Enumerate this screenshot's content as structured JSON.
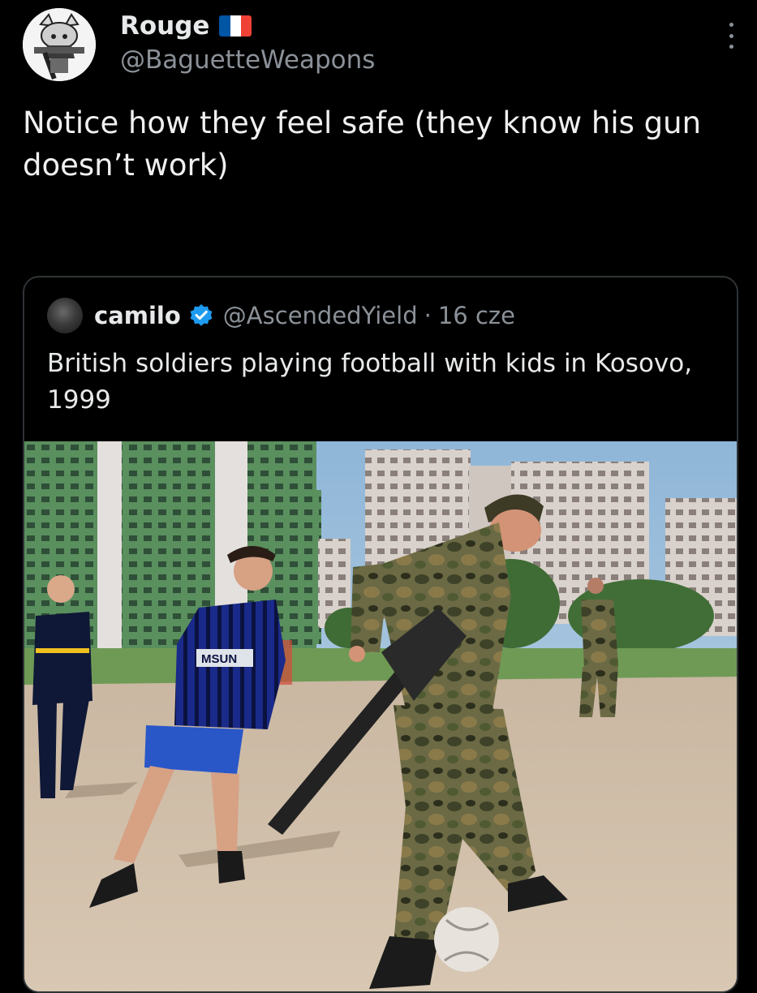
{
  "tweet": {
    "display_name": "Rouge",
    "flag_icon": "france-flag-icon",
    "handle": "@BaguetteWeapons",
    "text": "Notice how they feel safe (they know his gun doesn’t work)",
    "more_icon": "more-options-icon"
  },
  "quoted": {
    "display_name": "camilo",
    "verified_icon": "verified-badge-icon",
    "handle": "@AscendedYield",
    "separator": "·",
    "time": "16 cze",
    "text": "British soldiers playing football with kids in Kosovo, 1999",
    "photo_shirt_text": "MSUN"
  },
  "colors": {
    "background": "#000000",
    "text": "#e7e9ea",
    "secondary": "#8b9198",
    "verified": "#1d9bf0",
    "flag_blue": "#0055a4",
    "flag_white": "#ffffff",
    "flag_red": "#ef4135"
  }
}
